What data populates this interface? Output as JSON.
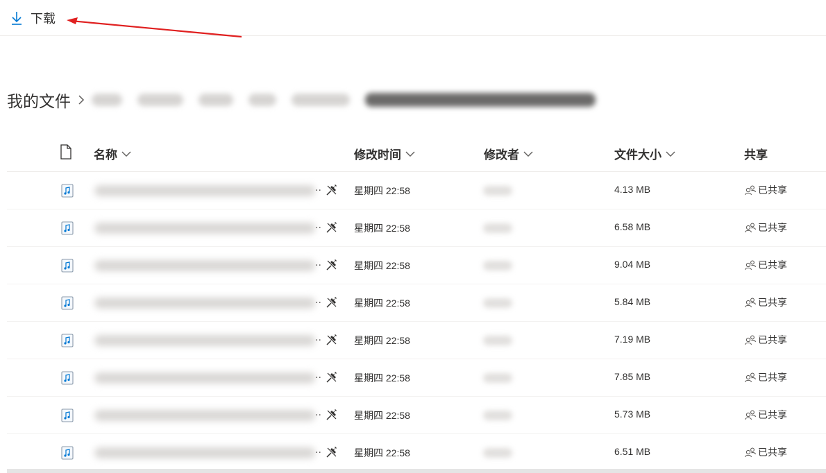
{
  "toolbar": {
    "download_label": "下载"
  },
  "breadcrumb": {
    "root": "我的文件"
  },
  "table": {
    "headers": {
      "name": "名称",
      "modified": "修改时间",
      "modified_by": "修改者",
      "size": "文件大小",
      "sharing": "共享"
    },
    "rows": [
      {
        "modified": "星期四 22:58",
        "size": "4.13 MB",
        "sharing": "已共享"
      },
      {
        "modified": "星期四 22:58",
        "size": "6.58 MB",
        "sharing": "已共享"
      },
      {
        "modified": "星期四 22:58",
        "size": "9.04 MB",
        "sharing": "已共享"
      },
      {
        "modified": "星期四 22:58",
        "size": "5.84 MB",
        "sharing": "已共享"
      },
      {
        "modified": "星期四 22:58",
        "size": "7.19 MB",
        "sharing": "已共享"
      },
      {
        "modified": "星期四 22:58",
        "size": "7.85 MB",
        "sharing": "已共享"
      },
      {
        "modified": "星期四 22:58",
        "size": "5.73 MB",
        "sharing": "已共享"
      },
      {
        "modified": "星期四 22:58",
        "size": "6.51 MB",
        "sharing": "已共享"
      }
    ]
  },
  "colors": {
    "accent": "#0078d4",
    "annotation_arrow": "#e02020",
    "text": "#323130"
  },
  "icons": [
    "download-icon",
    "file-header-icon",
    "audio-file-icon",
    "pin-icon",
    "shared-people-icon",
    "chevron-down-icon",
    "chevron-right-icon"
  ]
}
